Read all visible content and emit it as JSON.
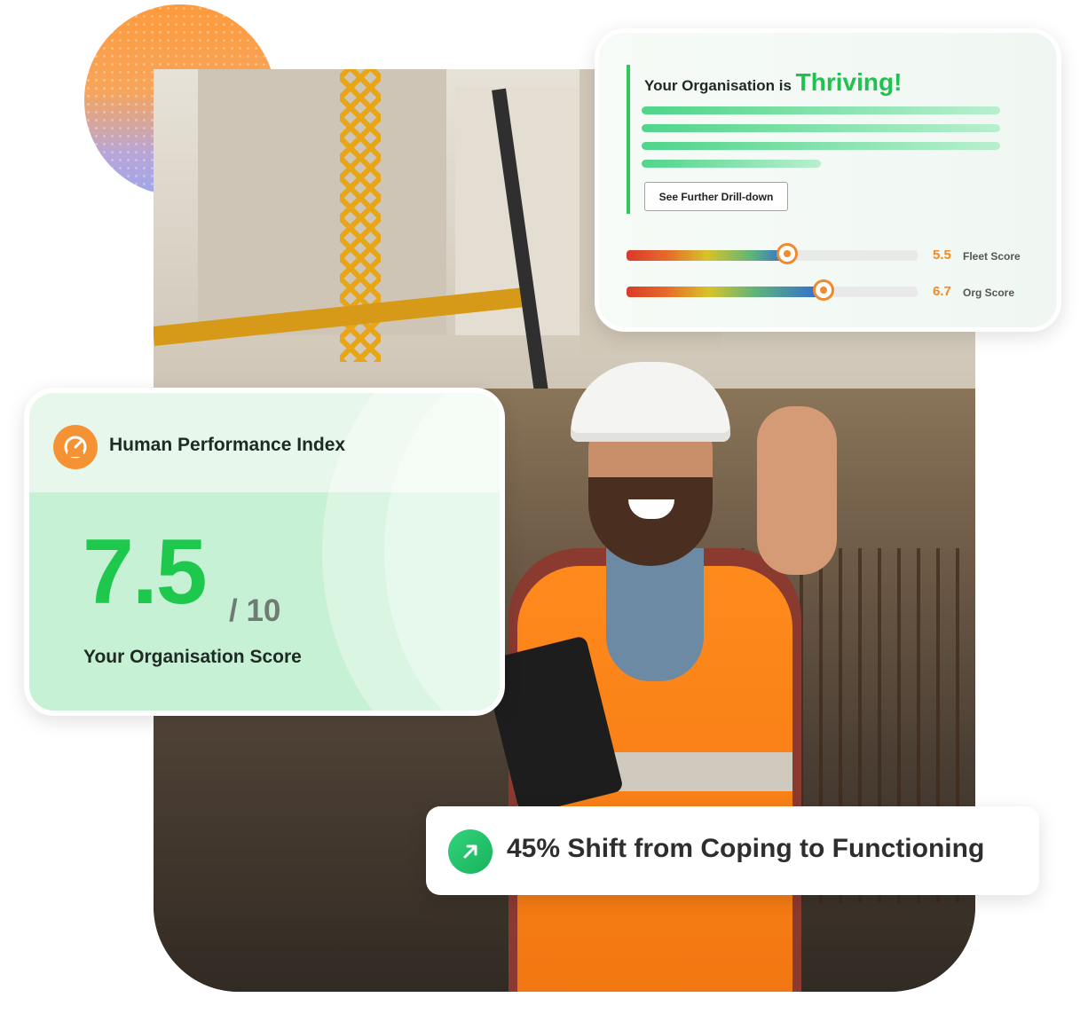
{
  "thriving_card": {
    "title_prefix": "Your Organisation is",
    "title_highlight": "Thriving!",
    "drill_button": "See Further Drill-down",
    "scores": [
      {
        "value": "5.5",
        "label": "Fleet Score",
        "level": 0.55
      },
      {
        "value": "6.7",
        "label": "Org Score",
        "level": 0.67
      }
    ]
  },
  "hpi_card": {
    "title": "Human Performance Index",
    "score": "7.5",
    "out_of": "/ 10",
    "subtitle": "Your Organisation Score",
    "icon": "gauge-icon"
  },
  "shift_card": {
    "text": "45% Shift from Coping to Functioning",
    "icon": "arrow-up-right-icon"
  },
  "colors": {
    "accent_green": "#20c24f",
    "accent_orange": "#f08a2a",
    "card_bg": "#f4fbf6"
  }
}
